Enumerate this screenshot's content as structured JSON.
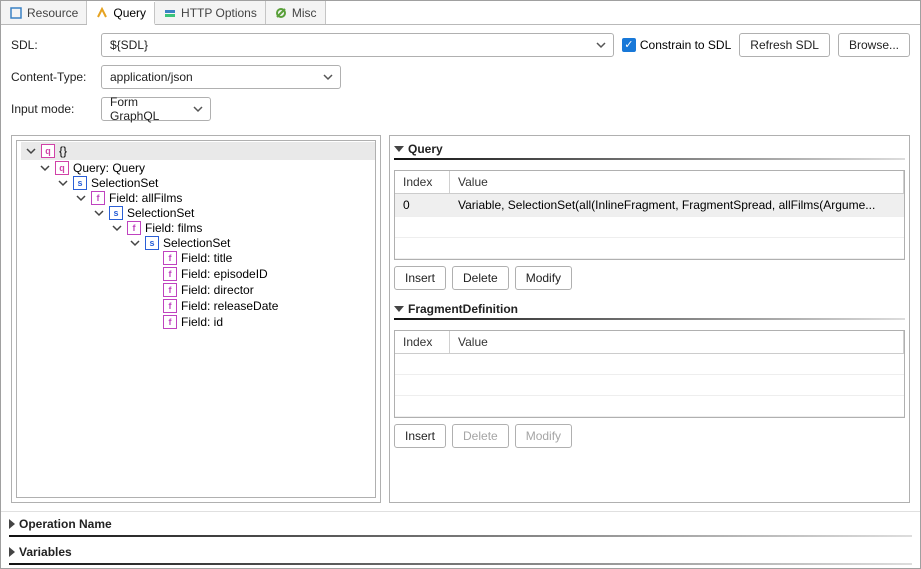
{
  "tabs": [
    {
      "label": "Resource"
    },
    {
      "label": "Query"
    },
    {
      "label": "HTTP Options"
    },
    {
      "label": "Misc"
    }
  ],
  "active_tab": 1,
  "rows": {
    "sdl": {
      "label": "SDL:",
      "value": "${SDL}"
    },
    "constrain": {
      "label": "Constrain to SDL",
      "checked": true
    },
    "refresh": "Refresh SDL",
    "browse": "Browse...",
    "content_type": {
      "label": "Content-Type:",
      "value": "application/json"
    },
    "input_mode": {
      "label": "Input mode:",
      "value": "Form GraphQL"
    }
  },
  "tree": {
    "root": {
      "icon": "q",
      "label": "{}"
    },
    "query": {
      "icon": "q",
      "label": "Query: Query"
    },
    "selset1": {
      "icon": "s",
      "label": "SelectionSet"
    },
    "field_allfilms": {
      "icon": "f",
      "label": "Field: allFilms"
    },
    "selset2": {
      "icon": "s",
      "label": "SelectionSet"
    },
    "field_films": {
      "icon": "f",
      "label": "Field: films"
    },
    "selset3": {
      "icon": "s",
      "label": "SelectionSet"
    },
    "field_title": {
      "icon": "f",
      "label": "Field: title"
    },
    "field_episode": {
      "icon": "f",
      "label": "Field: episodeID"
    },
    "field_director": {
      "icon": "f",
      "label": "Field: director"
    },
    "field_release": {
      "icon": "f",
      "label": "Field: releaseDate"
    },
    "field_id": {
      "icon": "f",
      "label": "Field: id"
    }
  },
  "right": {
    "query_section": {
      "title": "Query",
      "headers": {
        "index": "Index",
        "value": "Value"
      },
      "rows": [
        {
          "index": "0",
          "value": "Variable, SelectionSet(all(InlineFragment, FragmentSpread, allFilms(Argume..."
        }
      ],
      "buttons": {
        "insert": "Insert",
        "delete": "Delete",
        "modify": "Modify"
      },
      "buttons_enabled": {
        "insert": true,
        "delete": true,
        "modify": true
      }
    },
    "fragdef_section": {
      "title": "FragmentDefinition",
      "headers": {
        "index": "Index",
        "value": "Value"
      },
      "rows": [],
      "buttons": {
        "insert": "Insert",
        "delete": "Delete",
        "modify": "Modify"
      },
      "buttons_enabled": {
        "insert": true,
        "delete": false,
        "modify": false
      }
    }
  },
  "footer": {
    "opname": "Operation Name",
    "variables": "Variables"
  }
}
